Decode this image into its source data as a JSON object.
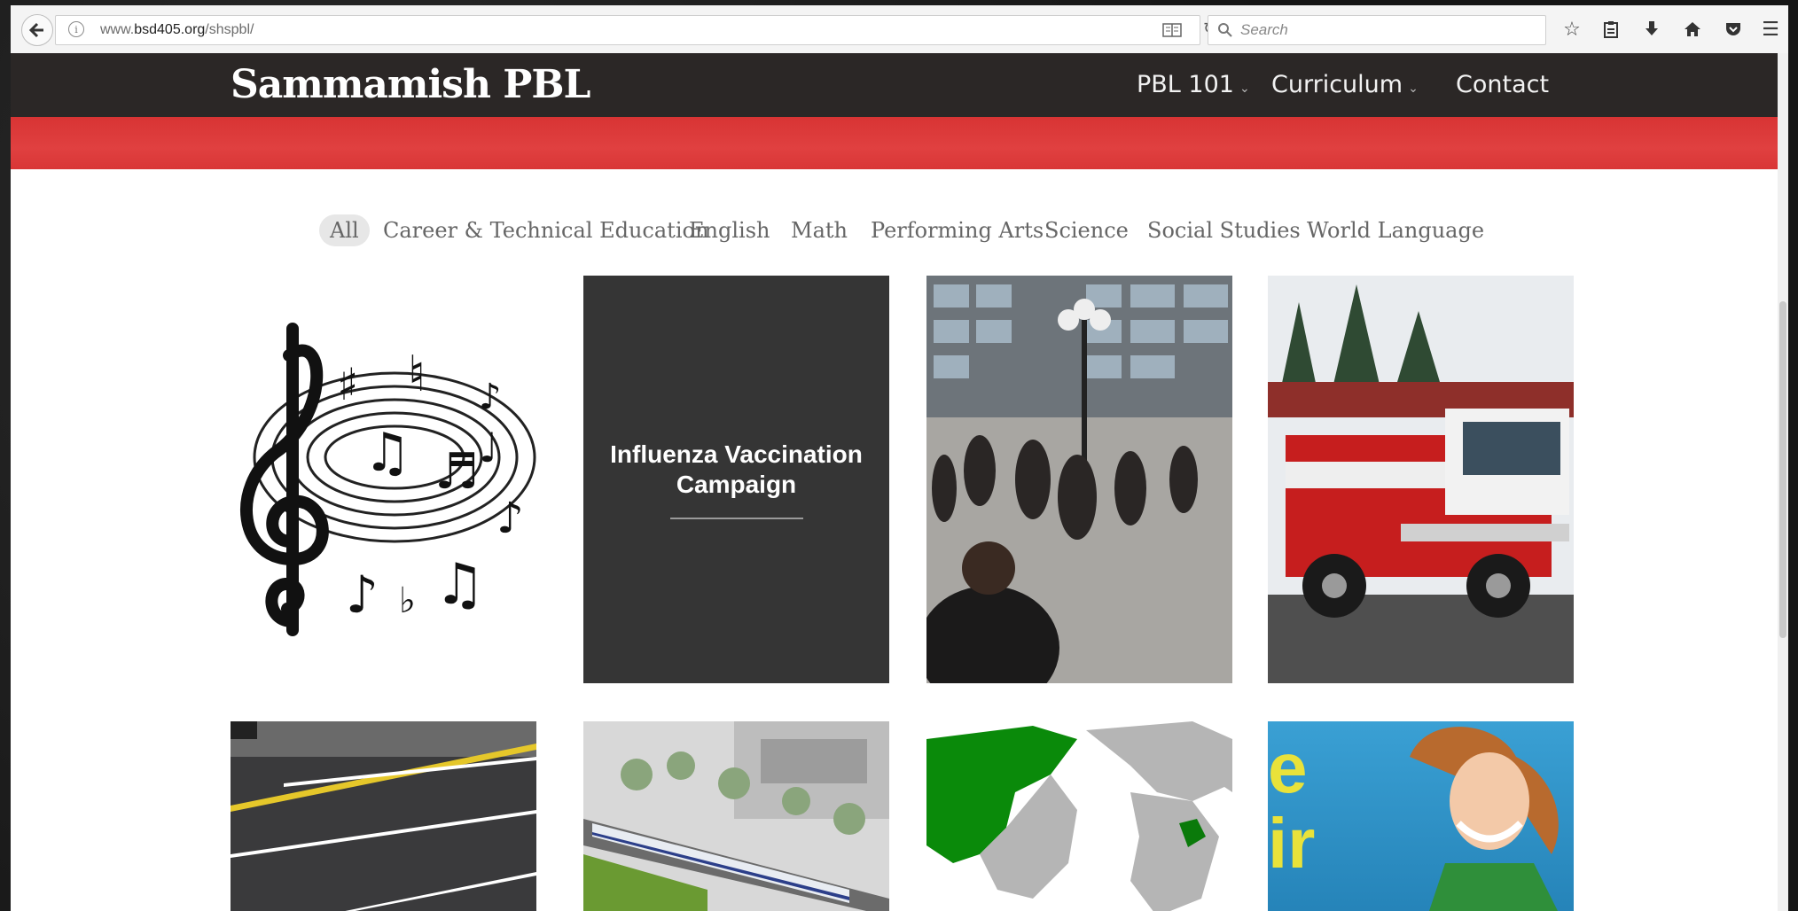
{
  "browser": {
    "url_prefix": "www.",
    "url_domain": "bsd405.org",
    "url_path": "/shspbl/",
    "search_placeholder": "Search"
  },
  "site": {
    "title": "Sammamish PBL",
    "nav": [
      {
        "label": "PBL 101",
        "caret": "⌄"
      },
      {
        "label": "Curriculum",
        "caret": "⌄"
      },
      {
        "label": "Contact"
      }
    ]
  },
  "filters": [
    "All",
    "Career & Technical Education",
    "English",
    "Math",
    "Performing Arts",
    "Science",
    "Social Studies",
    "World Language"
  ],
  "active_filter": "All",
  "projects": [
    {
      "type": "image",
      "icon": "music-notes-image"
    },
    {
      "type": "text",
      "title": "Influenza Vaccination Campaign"
    },
    {
      "type": "image",
      "icon": "flash-mob-photo"
    },
    {
      "type": "image",
      "icon": "fire-truck-photo"
    },
    {
      "type": "image",
      "icon": "parking-lot-photo"
    },
    {
      "type": "image",
      "icon": "light-rail-rendering"
    },
    {
      "type": "image",
      "icon": "world-map-image"
    },
    {
      "type": "image",
      "icon": "woman-poster-image",
      "poster_text": [
        "e",
        "ir"
      ]
    }
  ],
  "colors": {
    "header_bg": "#2b2726",
    "band_red": "#de3a3a",
    "tile_dark": "#353535",
    "map_green": "#0a8a0a"
  }
}
